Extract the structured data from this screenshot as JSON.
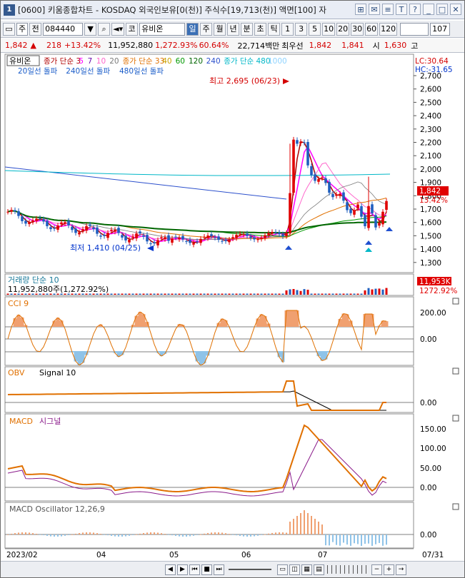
{
  "window": {
    "number": "1",
    "title": "[0600] 키움종합차트 - KOSDAQ 외국인보유[0(천)] 주식수[19,713(천)] 액면[100] 자",
    "buttons": [
      "⊞",
      "✉",
      "≡",
      "T",
      "?",
      "_",
      "□",
      "✕"
    ]
  },
  "toolbar": {
    "type_select": "주",
    "prev_label": "전",
    "code": "084440",
    "code_dropdown": "▼",
    "market": "코",
    "stock_name": "유비온",
    "periods": [
      "일",
      "주",
      "월",
      "년",
      "분",
      "초",
      "틱"
    ],
    "active_period": "일",
    "intervals": [
      "1",
      "3",
      "5",
      "10",
      "20",
      "30",
      "60",
      "120"
    ],
    "count": "107"
  },
  "quote": {
    "price": "1,842",
    "arrow": "▲",
    "change": "218",
    "rate": "+13.42%",
    "volume": "11,952,880",
    "vol_rate": "1,272.93%",
    "turnover": "60.64%",
    "amount": "22,714백만",
    "best_label": "최우선",
    "ask": "1,842",
    "bid": "1,841",
    "open_label": "시",
    "open": "1,630",
    "high_label": "고"
  },
  "panels": {
    "price": {
      "legend_name": "유비온",
      "legend": [
        {
          "label": "종가 단순 3",
          "color": "#b00000"
        },
        {
          "label": "5",
          "color": "#ff00ff"
        },
        {
          "label": "7",
          "color": "#6a0dad"
        },
        {
          "label": "10",
          "color": "#ff66cc"
        },
        {
          "label": "20",
          "color": "#7a7a7a"
        },
        {
          "label": "종가 단순 33",
          "color": "#e07000"
        },
        {
          "label": "40",
          "color": "#c8a000"
        },
        {
          "label": "60",
          "color": "#009900"
        },
        {
          "label": "120",
          "color": "#006600"
        },
        {
          "label": "240",
          "color": "#2b4fcc"
        },
        {
          "label": "종가 단순 480",
          "color": "#00b7c7"
        },
        {
          "label": "1000",
          "color": "#8fd3ff"
        }
      ],
      "legend2": [
        {
          "label": "20일선 돌파",
          "color": "#1a5cc9"
        },
        {
          "label": "240일선 돌파",
          "color": "#1a5cc9"
        },
        {
          "label": "480일선 돌파",
          "color": "#1a5cc9"
        }
      ],
      "lc": "LC:30.64",
      "hc": "HC:-31.65",
      "high_note": "최고 2,695 (06/23)",
      "low_note": "최저 1,410 (04/25)",
      "price_tag": "1,842",
      "rate_tag": "13.42%",
      "yticks": [
        "2,700",
        "2,600",
        "2,500",
        "2,400",
        "2,300",
        "2,200",
        "2,100",
        "2,000",
        "1,900",
        "1,800",
        "1,700",
        "1,600",
        "1,500",
        "1,400",
        "1,300"
      ]
    },
    "volume": {
      "title": "거래량 단순 10",
      "value": "11,952,880주(1,272.92%)",
      "tag1": "11,953K",
      "tag2": "1272.92%"
    },
    "cci": {
      "title": "CCI 9",
      "yticks": [
        "200.00",
        "0.00"
      ]
    },
    "obv": {
      "title": "OBV",
      "signal": "Signal 10",
      "yticks": [
        "0.00"
      ]
    },
    "macd": {
      "title": "MACD",
      "signal": "시그널",
      "yticks": [
        "150.00",
        "100.00",
        "50.00",
        "0.00"
      ]
    },
    "osc": {
      "title": "MACD Oscillator 12,26,9",
      "yticks": [
        "0.00"
      ]
    }
  },
  "xaxis": {
    "labels": [
      "2023/02",
      "04",
      "05",
      "06",
      "07"
    ],
    "right": "07/31"
  },
  "colors": {
    "up": "#e00000",
    "down": "#1f5fbf",
    "accent": "#3b6fb5"
  }
}
